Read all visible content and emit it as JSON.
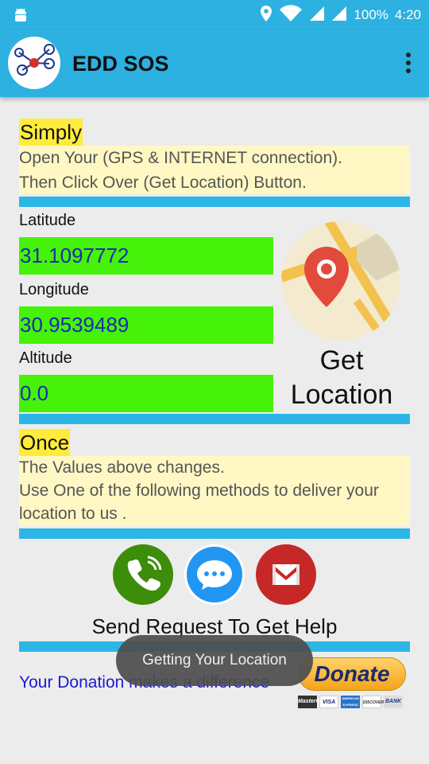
{
  "status_bar": {
    "battery": "100%",
    "time": "4:20"
  },
  "app_bar": {
    "title": "EDD SOS"
  },
  "step1": {
    "heading": "Simply",
    "line1": "Open Your (GPS & INTERNET connection).",
    "line2": "Then Click Over (Get Location) Button."
  },
  "location": {
    "latitude_label": "Latitude",
    "latitude_value": "31.1097772",
    "longitude_label": "Longitude",
    "longitude_value": "30.9539489",
    "altitude_label": "Altitude",
    "altitude_value": "0.0",
    "get_location_line1": "Get",
    "get_location_line2": "Location"
  },
  "step2": {
    "heading": "Once",
    "line1": "The Values above changes.",
    "line2": "Use One of the following methods to deliver your",
    "line3": "location to us ."
  },
  "actions": {
    "send_text": "Send Request To Get Help",
    "call_icon": "phone-icon",
    "sms_icon": "message-icon",
    "email_icon": "gmail-icon"
  },
  "toast": {
    "text": "Getting Your Location"
  },
  "donation": {
    "text": "Your Donation makes a difference",
    "button_label": "Donate",
    "cards": [
      "MasterCard",
      "VISA",
      "AMERICAN EXPRESS",
      "DISCOVER",
      "BANK"
    ]
  },
  "colors": {
    "primary": "#2cb1e1",
    "value_bg": "#47f20a",
    "value_text": "#1c2bb5",
    "highlight": "#ffeb3b",
    "panel_bg": "#fff8c4",
    "call_green": "#3c8d09",
    "sms_blue": "#2196f3",
    "email_red": "#c62828"
  }
}
